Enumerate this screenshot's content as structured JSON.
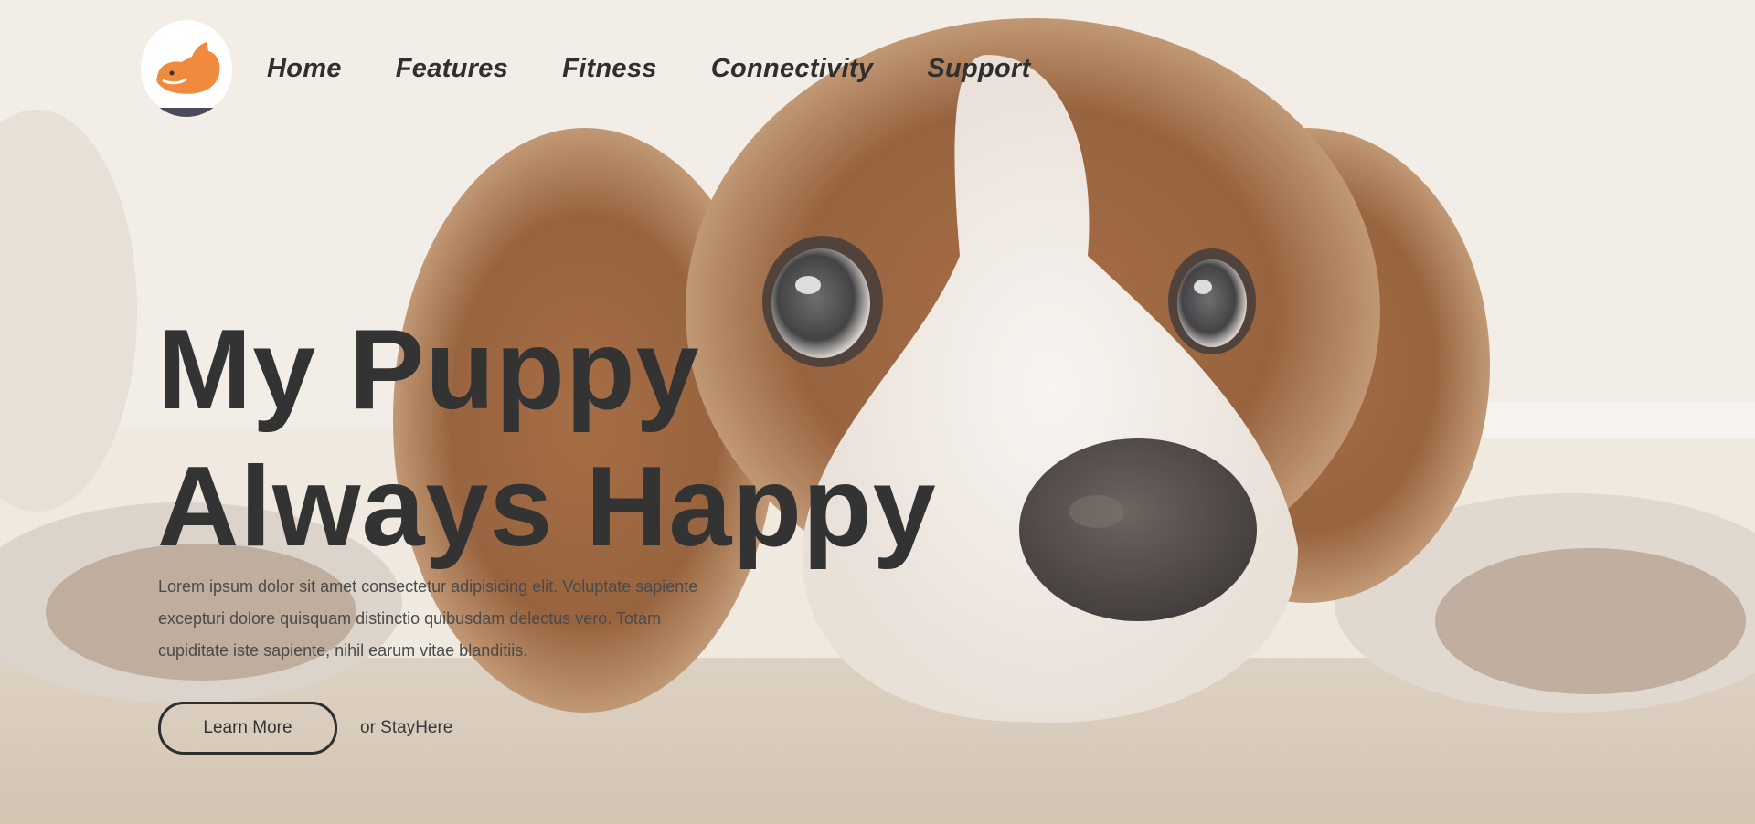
{
  "nav": {
    "logo_alt": "corgi-logo",
    "items": [
      {
        "label": "Home"
      },
      {
        "label": "Features"
      },
      {
        "label": "Fitness"
      },
      {
        "label": "Connectivity"
      },
      {
        "label": "Support"
      }
    ]
  },
  "hero": {
    "headline_line1": "My Puppy",
    "headline_line2": "Always Happy",
    "lead": "Lorem ipsum dolor sit amet consectetur adipisicing elit. Voluptate sapiente excepturi dolore quisquam distinctio quibusdam delectus vero. Totam cupiditate iste sapiente, nihil earum vitae blanditiis.",
    "primary_button": "Learn More",
    "secondary_link": "or StayHere",
    "background_image": "puppy-photo"
  },
  "colors": {
    "text_dark": "#333333",
    "nav_text": "#2f2f2f",
    "lead_text": "#4a4a4a",
    "logo_fox": "#f08a3c",
    "background": "#efe7dc"
  }
}
